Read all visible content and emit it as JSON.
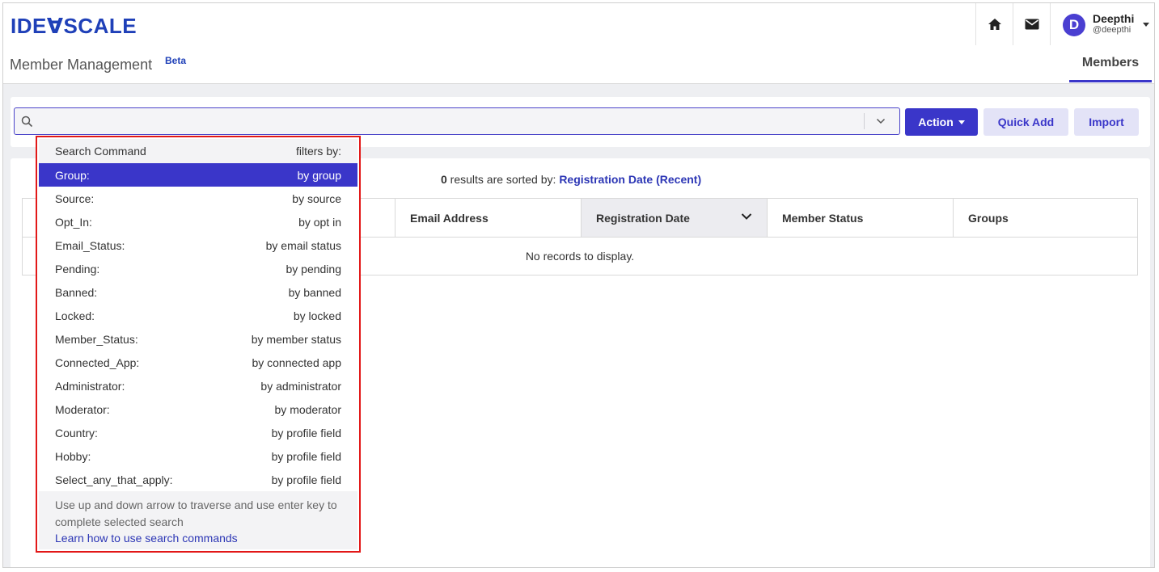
{
  "header": {
    "logo": "IDEⱯSCALE",
    "user": {
      "initial": "D",
      "name": "Deepthi",
      "handle": "@deepthi"
    }
  },
  "subheader": {
    "title": "Member Management",
    "badge": "Beta",
    "tab": "Members"
  },
  "toolbar": {
    "search_value": "",
    "action_label": "Action",
    "quick_add_label": "Quick Add",
    "import_label": "Import"
  },
  "results": {
    "count": "0",
    "sorted_text": " results are sorted by: ",
    "sort_field": "Registration Date (Recent)",
    "columns": [
      "",
      "Email Address",
      "Registration Date",
      "Member Status",
      "Groups"
    ],
    "empty_text": "No records to display."
  },
  "dropdown": {
    "head_left": "Search Command",
    "head_right": "filters by:",
    "items": [
      {
        "cmd": "Group:",
        "desc": "by group"
      },
      {
        "cmd": "Source:",
        "desc": "by source"
      },
      {
        "cmd": "Opt_In:",
        "desc": "by opt in"
      },
      {
        "cmd": "Email_Status:",
        "desc": "by email status"
      },
      {
        "cmd": "Pending:",
        "desc": "by pending"
      },
      {
        "cmd": "Banned:",
        "desc": "by banned"
      },
      {
        "cmd": "Locked:",
        "desc": "by locked"
      },
      {
        "cmd": "Member_Status:",
        "desc": "by member status"
      },
      {
        "cmd": "Connected_App:",
        "desc": "by connected app"
      },
      {
        "cmd": "Administrator:",
        "desc": "by administrator"
      },
      {
        "cmd": "Moderator:",
        "desc": "by moderator"
      },
      {
        "cmd": "Country:",
        "desc": "by profile field"
      },
      {
        "cmd": "Hobby:",
        "desc": "by profile field"
      },
      {
        "cmd": "Select_any_that_apply:",
        "desc": "by profile field"
      }
    ],
    "help_text": "Use up and down arrow to traverse and use enter key to complete selected search",
    "help_link": "Learn how to use search commands"
  },
  "colors": {
    "brand": "#1f40b8",
    "accent": "#3a36c9",
    "highlight_border": "#e21818"
  }
}
